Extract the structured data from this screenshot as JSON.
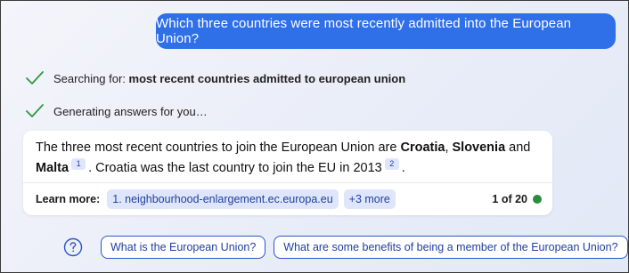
{
  "user_message": "Which three countries were most recently admitted into the European Union?",
  "status": [
    {
      "prefix": "Searching for: ",
      "bold": "most recent countries admitted to european union",
      "icon": "check-icon"
    },
    {
      "prefix": "Generating answers for you…",
      "bold": "",
      "icon": "check-icon"
    }
  ],
  "answer": {
    "part1": "The three most recent countries to join the European Union are ",
    "country1": "Croatia",
    "sep1": ", ",
    "country2": "Slovenia",
    "and": " and",
    "country3": "Malta",
    "cite1": "1",
    "part2": ". Croatia was the last country to join the EU in 2013",
    "cite2": "2",
    "end": "."
  },
  "learn_more": {
    "label": "Learn more:",
    "links": [
      "1. neighbourhood-enlargement.ec.europa.eu",
      "+3 more"
    ],
    "page_count": "1 of 20",
    "status_color": "#2e8b3e"
  },
  "suggestions": [
    "What is the European Union?",
    "What are some benefits of being a member of the European Union?"
  ],
  "colors": {
    "accent": "#2f6fe8",
    "check": "#2e9a3f",
    "chip_bg": "#dfe6fb",
    "chip_text": "#1f3fa0"
  }
}
